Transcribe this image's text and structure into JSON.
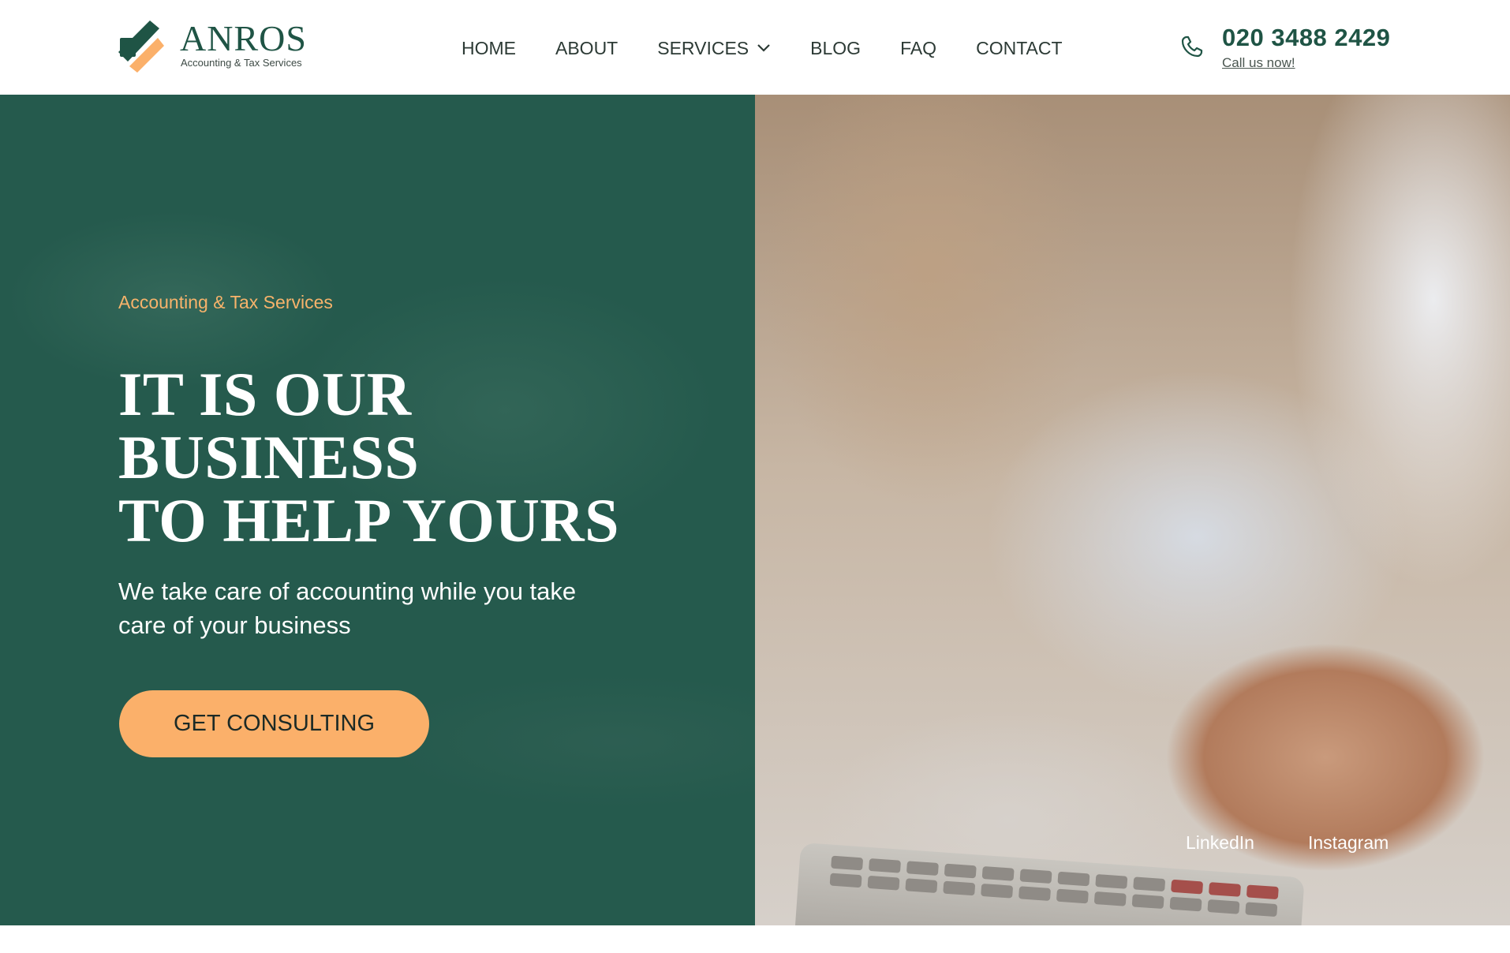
{
  "brand": {
    "name": "ANROS",
    "tagline": "Accounting & Tax Services",
    "logo_icon": "anros-logo-icon",
    "colors": {
      "primary": "#1f5445",
      "accent": "#fbb06a",
      "hero_green": "#255a4d"
    }
  },
  "nav": {
    "items": [
      {
        "label": "HOME"
      },
      {
        "label": "ABOUT"
      },
      {
        "label": "SERVICES",
        "has_dropdown": true,
        "icon": "chevron-down-icon"
      },
      {
        "label": "BLOG"
      },
      {
        "label": "FAQ"
      },
      {
        "label": "CONTACT"
      }
    ]
  },
  "contact": {
    "icon": "phone-icon",
    "phone": "020 3488 2429",
    "cta_link": "Call us now!"
  },
  "hero": {
    "eyebrow": "Accounting & Tax Services",
    "headline_lines": [
      "IT IS OUR",
      "BUSINESS",
      "TO HELP YOURS"
    ],
    "subtext": "We take care of accounting while you take care of your business",
    "button_label": "GET CONSULTING"
  },
  "social": {
    "linkedin": "LinkedIn",
    "instagram": "Instagram"
  }
}
